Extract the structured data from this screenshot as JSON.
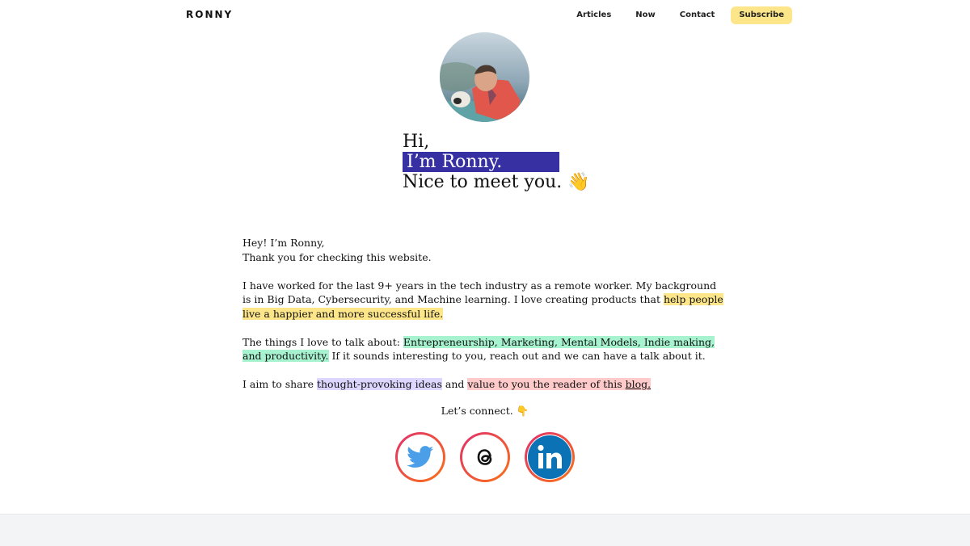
{
  "header": {
    "brand": "RONNY",
    "nav": [
      "Articles",
      "Now",
      "Contact"
    ],
    "subscribe_label": "Subscribe"
  },
  "hero": {
    "line1": "Hi,",
    "line2": "I’m Ronny.",
    "line3": "Nice to meet you. 👋"
  },
  "intro": {
    "p1_line1": "Hey! I’m Ronny,",
    "p1_line2": "Thank you for checking this website.",
    "p2_text": "I have worked for the last 9+ years in the tech industry as a remote worker. My background is in Big Data, Cybersecurity, and Machine learning. I love creating products that ",
    "p2_highlight": "help people live a happier and more successful life.",
    "p3_text": "The things I love to talk about: ",
    "p3_highlight": "Entrepreneurship, Marketing, Mental Models, Indie making, and productivity.",
    "p3_tail": " If it sounds interesting to you, reach out and we can have a talk about it.",
    "p4_text": "I aim to share ",
    "p4_highlight1": "thought-provoking ideas",
    "p4_mid": " and ",
    "p4_highlight2": "value to you the reader of this ",
    "p4_link": "blog."
  },
  "connect": {
    "label": "Let’s connect. 👇"
  },
  "socials": [
    {
      "name": "twitter-icon"
    },
    {
      "name": "threads-icon"
    },
    {
      "name": "linkedin-icon"
    }
  ],
  "colors": {
    "accent": "#3730a3",
    "highlight_yellow": "#fde68a",
    "highlight_green": "#a7f3d0",
    "highlight_purple": "#ddd6fe",
    "highlight_red": "#fecaca"
  }
}
